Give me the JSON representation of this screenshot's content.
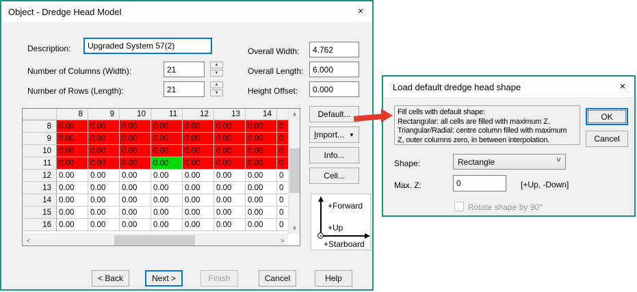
{
  "colors": {
    "dialog_border": "#17927E",
    "focus_blue": "#0078d7",
    "cell_red": "#fe0000",
    "cell_green": "#00dc00",
    "arrow_red": "#e23a2c"
  },
  "icons": {
    "close": "×",
    "dropdown": "▼",
    "combo_chevron": "˅",
    "spin_up": "▲",
    "spin_down": "▼",
    "scroll_up": "∧",
    "scroll_down": "∨",
    "scroll_left": "<",
    "scroll_right": ">"
  },
  "left_dialog": {
    "title": "Object - Dredge Head Model",
    "fields": {
      "description_label": "Description:",
      "description_value": "Upgraded System 57(2)",
      "cols_label": "Number of Columns (Width):",
      "cols_value": "21",
      "rows_label": "Number of Rows (Length):",
      "rows_value": "21",
      "overall_width_label": "Overall Width:",
      "overall_width_value": "4.762",
      "overall_length_label": "Overall Length:",
      "overall_length_value": "6.000",
      "height_offset_label": "Height Offset:",
      "height_offset_value": "0.000"
    },
    "side_buttons": {
      "default": "Default...",
      "import_first": "I",
      "import_rest": "mport...",
      "info": "Info...",
      "cell": "Cell..."
    },
    "axes": {
      "forward": "+Forward",
      "up": "+Up",
      "starboard": "+Starboard"
    },
    "bottom_buttons": {
      "back": "< Back",
      "next": "Next >",
      "finish": "Finish",
      "cancel": "Cancel",
      "help": "Help"
    },
    "grid": {
      "col_headers": [
        "8",
        "9",
        "10",
        "11",
        "12",
        "13",
        "14"
      ],
      "row_headers": [
        "8",
        "9",
        "10",
        "11",
        "12",
        "13",
        "14",
        "15",
        "16"
      ],
      "cell_value": "0.00",
      "sliver_text": "0",
      "red_row_indexes": [
        0,
        1,
        2,
        3
      ],
      "green_cell": {
        "row_index": 3,
        "col_index": 3
      }
    }
  },
  "right_dialog": {
    "title": "Load default dredge head shape",
    "info_lines": [
      "Fill cells with default shape:",
      "Rectangular: all cells are filled with maximum Z.",
      "Triangular/Radial: centre column filled with maximum",
      "Z, outer columns zero, in between interpolation."
    ],
    "ok": "OK",
    "cancel": "Cancel",
    "shape_label": "Shape:",
    "shape_value": "Rectangle",
    "maxz_label": "Max. Z:",
    "maxz_value": "0",
    "maxz_hint": "[+Up, -Down]",
    "rotate_label": "Rotate shape by 90°"
  }
}
